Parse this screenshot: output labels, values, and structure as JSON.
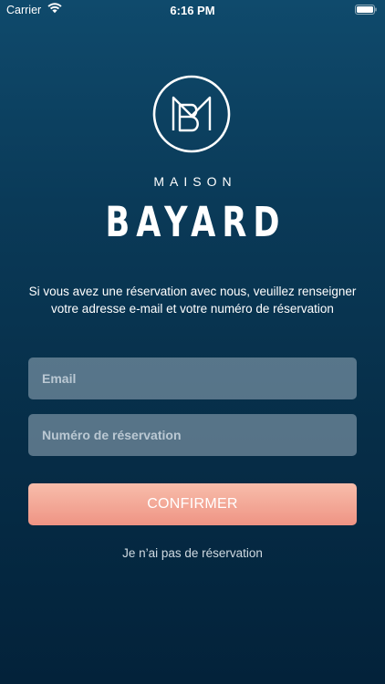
{
  "status_bar": {
    "carrier": "Carrier",
    "time": "6:16 PM",
    "wifi_icon": "wifi-icon",
    "battery_icon": "battery-full-icon"
  },
  "brand": {
    "logo_icon": "maison-bayard-monogram-icon",
    "top_word": "MAISON",
    "main_word": "BAYARD"
  },
  "intro": {
    "line1": "Si vous avez une réservation avec nous, veuillez renseigner",
    "line2": "votre adresse e-mail et votre numéro de réservation"
  },
  "form": {
    "email": {
      "placeholder": "Email",
      "value": ""
    },
    "reservation_number": {
      "placeholder": "Numéro de réservation",
      "value": ""
    },
    "confirm_label": "CONFIRMER"
  },
  "links": {
    "no_reservation": "Je n’ai pas de réservation"
  },
  "colors": {
    "background_top": "#0f4a6c",
    "background_bottom": "#03223a",
    "button_top": "#f7bdab",
    "button_bottom": "#ef9484",
    "input_fill": "#a8bac8"
  }
}
